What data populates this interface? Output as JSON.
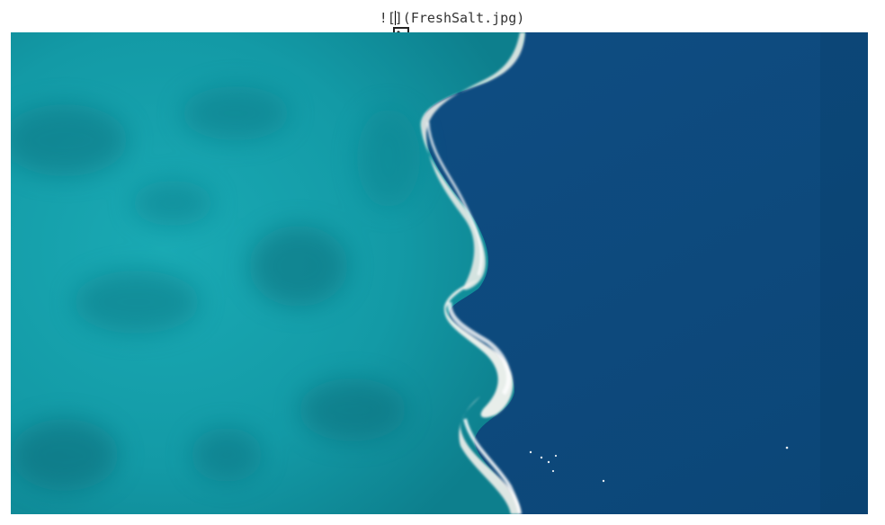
{
  "caption": {
    "icon": "image-icon",
    "prefix": "![",
    "suffix": "](FreshSalt.jpg)"
  },
  "image": {
    "description_icon": "aerial-ocean-photo",
    "colors": {
      "fresh_water": "#17a3ad",
      "salt_water": "#0f4f85",
      "foam": "#f2f2ee"
    }
  }
}
